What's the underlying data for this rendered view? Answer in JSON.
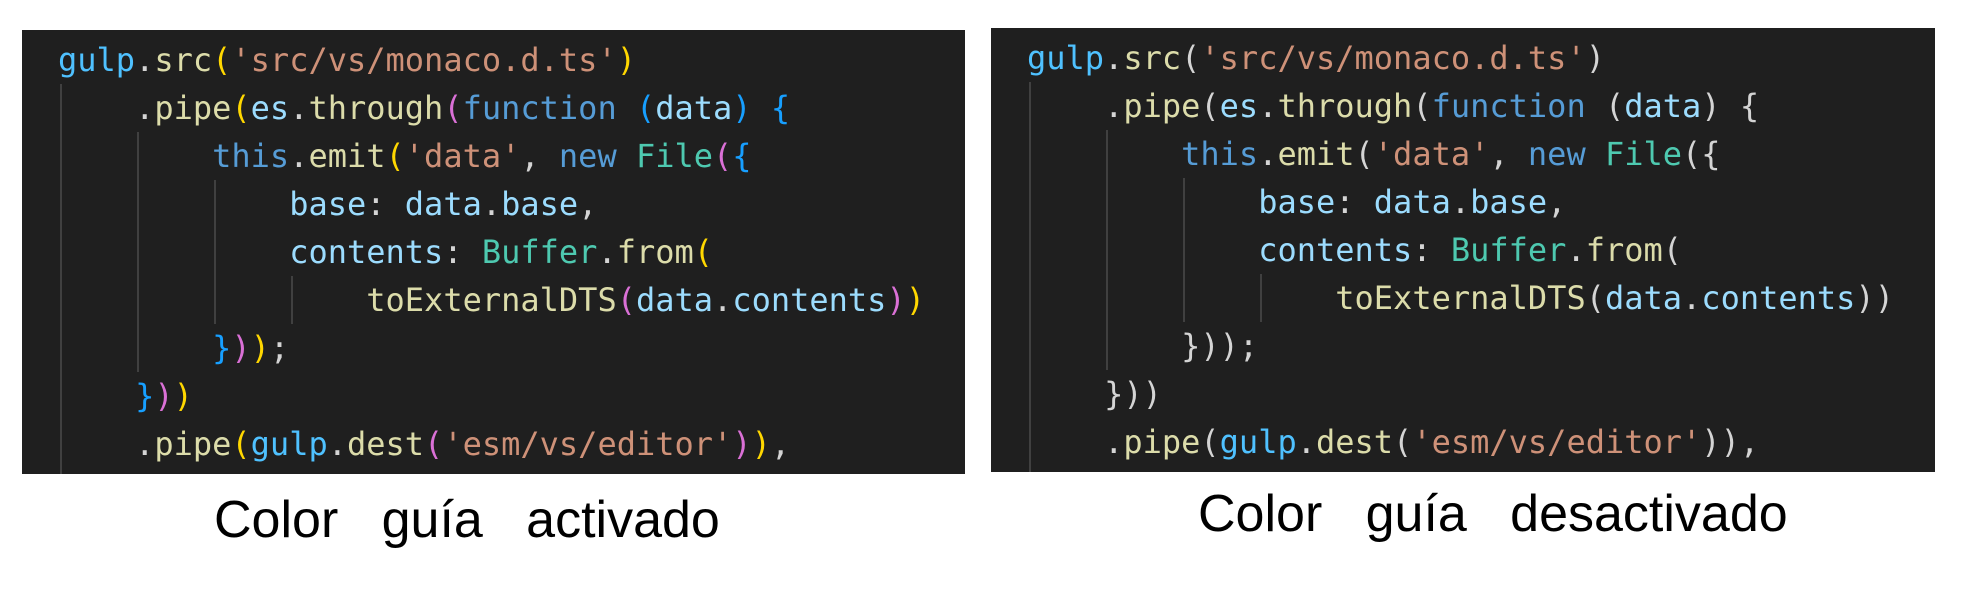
{
  "panels": [
    {
      "id": "left",
      "caption": "Color   guía   activado",
      "bracket_colors": true
    },
    {
      "id": "right",
      "caption": "Color   guía   desactivado",
      "bracket_colors": false
    }
  ],
  "code_lines": [
    {
      "indent": 0,
      "tokens": [
        {
          "t": "gulp",
          "k": "var"
        },
        {
          "t": ".",
          "k": "punc"
        },
        {
          "t": "src",
          "k": "fn"
        },
        {
          "t": "(",
          "k": "b1"
        },
        {
          "t": "'src/vs/monaco.d.ts'",
          "k": "str"
        },
        {
          "t": ")",
          "k": "b1"
        }
      ]
    },
    {
      "indent": 1,
      "tokens": [
        {
          "t": ".",
          "k": "punc"
        },
        {
          "t": "pipe",
          "k": "fn"
        },
        {
          "t": "(",
          "k": "b1"
        },
        {
          "t": "es",
          "k": "prop"
        },
        {
          "t": ".",
          "k": "punc"
        },
        {
          "t": "through",
          "k": "fn"
        },
        {
          "t": "(",
          "k": "b2"
        },
        {
          "t": "function",
          "k": "kw"
        },
        {
          "t": " ",
          "k": "punc"
        },
        {
          "t": "(",
          "k": "b3"
        },
        {
          "t": "data",
          "k": "prop"
        },
        {
          "t": ")",
          "k": "b3"
        },
        {
          "t": " ",
          "k": "punc"
        },
        {
          "t": "{",
          "k": "b3"
        }
      ]
    },
    {
      "indent": 2,
      "tokens": [
        {
          "t": "this",
          "k": "kw"
        },
        {
          "t": ".",
          "k": "punc"
        },
        {
          "t": "emit",
          "k": "fn"
        },
        {
          "t": "(",
          "k": "b1"
        },
        {
          "t": "'data'",
          "k": "str"
        },
        {
          "t": ", ",
          "k": "punc"
        },
        {
          "t": "new",
          "k": "kw"
        },
        {
          "t": " ",
          "k": "punc"
        },
        {
          "t": "File",
          "k": "cls"
        },
        {
          "t": "(",
          "k": "b2"
        },
        {
          "t": "{",
          "k": "b3"
        }
      ]
    },
    {
      "indent": 3,
      "tokens": [
        {
          "t": "base",
          "k": "prop"
        },
        {
          "t": ": ",
          "k": "punc"
        },
        {
          "t": "data",
          "k": "prop"
        },
        {
          "t": ".",
          "k": "punc"
        },
        {
          "t": "base",
          "k": "prop"
        },
        {
          "t": ",",
          "k": "punc"
        }
      ]
    },
    {
      "indent": 3,
      "tokens": [
        {
          "t": "contents",
          "k": "prop"
        },
        {
          "t": ": ",
          "k": "punc"
        },
        {
          "t": "Buffer",
          "k": "cls"
        },
        {
          "t": ".",
          "k": "punc"
        },
        {
          "t": "from",
          "k": "fn"
        },
        {
          "t": "(",
          "k": "b1"
        }
      ]
    },
    {
      "indent": 4,
      "tokens": [
        {
          "t": "toExternalDTS",
          "k": "fn"
        },
        {
          "t": "(",
          "k": "b2"
        },
        {
          "t": "data",
          "k": "prop"
        },
        {
          "t": ".",
          "k": "punc"
        },
        {
          "t": "contents",
          "k": "prop"
        },
        {
          "t": ")",
          "k": "b2"
        },
        {
          "t": ")",
          "k": "b1"
        }
      ]
    },
    {
      "indent": 2,
      "tokens": [
        {
          "t": "}",
          "k": "b3"
        },
        {
          "t": ")",
          "k": "b2"
        },
        {
          "t": ")",
          "k": "b1"
        },
        {
          "t": ";",
          "k": "punc"
        }
      ]
    },
    {
      "indent": 1,
      "tokens": [
        {
          "t": "}",
          "k": "b3"
        },
        {
          "t": ")",
          "k": "b2"
        },
        {
          "t": ")",
          "k": "b1"
        }
      ]
    },
    {
      "indent": 1,
      "tokens": [
        {
          "t": ".",
          "k": "punc"
        },
        {
          "t": "pipe",
          "k": "fn"
        },
        {
          "t": "(",
          "k": "b1"
        },
        {
          "t": "gulp",
          "k": "var"
        },
        {
          "t": ".",
          "k": "punc"
        },
        {
          "t": "dest",
          "k": "fn"
        },
        {
          "t": "(",
          "k": "b2"
        },
        {
          "t": "'esm/vs/editor'",
          "k": "str"
        },
        {
          "t": ")",
          "k": "b2"
        },
        {
          "t": ")",
          "k": "b1"
        },
        {
          "t": ",",
          "k": "punc"
        }
      ]
    }
  ],
  "colors": {
    "editor_background": "#1f1f1f",
    "bracket_level_1": "#ffd700",
    "bracket_level_2": "#da70d6",
    "bracket_level_3": "#179fff",
    "bracket_plain": "#d4d4d4"
  }
}
